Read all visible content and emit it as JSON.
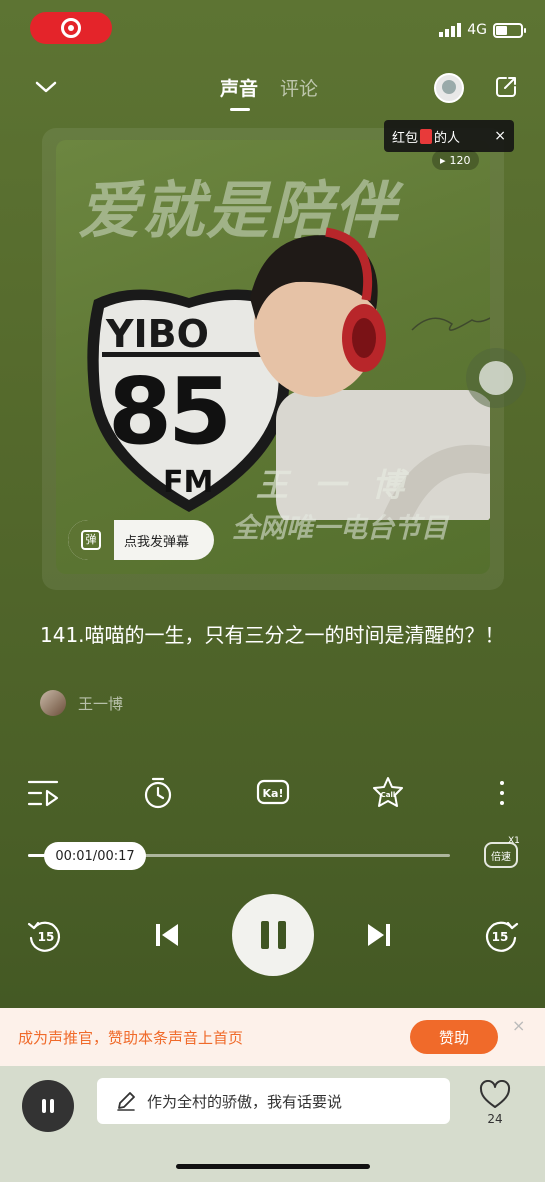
{
  "status_bar": {
    "network": "4G"
  },
  "header": {
    "tabs": [
      {
        "label": "声音",
        "active": true
      },
      {
        "label": "评论",
        "active": false
      }
    ]
  },
  "tooltip": {
    "prefix": "红包",
    "suffix": "的人",
    "close": "×"
  },
  "play_count": "120",
  "cover": {
    "big_title": "爱就是陪伴",
    "badge_top": "YIBO",
    "badge_number": "85",
    "badge_bottom": "FM",
    "host_name": "王一博",
    "tagline": "全网唯一电台节目"
  },
  "danmu": {
    "icon_char": "弹",
    "label": "点我发弹幕"
  },
  "track": {
    "title": "141.喵喵的一生，只有三分之一的时间是清醒的？！",
    "author": "王一博"
  },
  "player": {
    "time": "00:01/00:17",
    "progress": 0.06,
    "speed_label": "倍速",
    "speed_value": "X1",
    "skip_back": "15",
    "skip_forward": "15"
  },
  "sponsor": {
    "text": "成为声推官，赞助本条声音上首页",
    "button": "赞助",
    "close": "×"
  },
  "bottom": {
    "placeholder": "作为全村的骄傲，我有话要说",
    "like_count": "24"
  },
  "colors": {
    "accent": "#f06a2a",
    "bg": "#56692c"
  }
}
